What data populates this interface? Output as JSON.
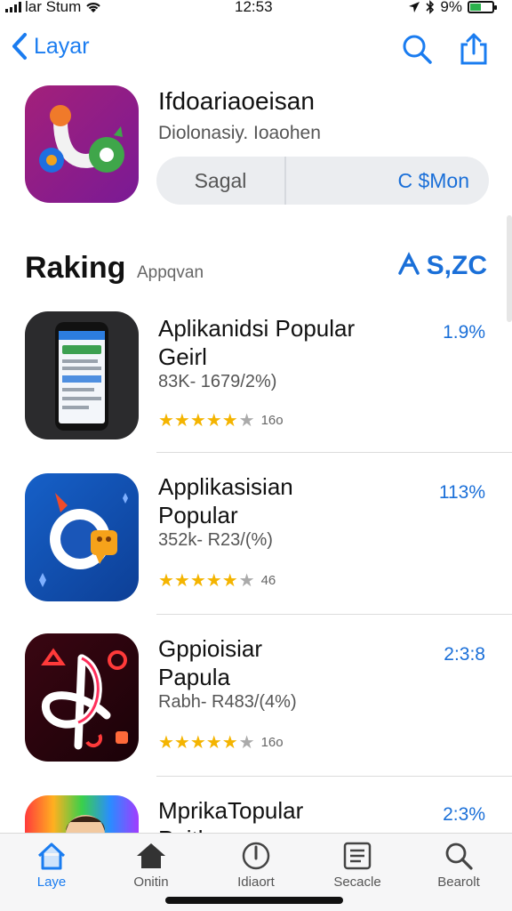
{
  "status": {
    "carrier": "lar Stum",
    "time": "12:53",
    "battery": "9%"
  },
  "nav": {
    "back_label": "Layar"
  },
  "hero": {
    "title": "Ifdoariaoeisan",
    "subtitle": "Diolonasiy. Ioaohen",
    "seg_left": "Sagal",
    "seg_right": "C $Mon"
  },
  "section": {
    "title": "Raking",
    "subtitle": "Appqvan",
    "link": "S,ZC"
  },
  "apps": [
    {
      "title_lines": [
        "Aplikanidsi Popular",
        "Geirl"
      ],
      "meta": "83K- 1679/2%)",
      "rating_count": "16o",
      "pct": "1.9%"
    },
    {
      "title_lines": [
        "Applikasisian",
        "Popular"
      ],
      "meta": "352k- R23/(%)",
      "rating_count": "46",
      "pct": "113%"
    },
    {
      "title_lines": [
        "Gppioisiar",
        "Papula"
      ],
      "meta": "Rabh- R483/(4%)",
      "rating_count": "16o",
      "pct": "2:3:8"
    },
    {
      "title_lines": [
        "MprikaTopular",
        "Poitl"
      ],
      "meta": "",
      "rating_count": "",
      "pct": "2:3%"
    }
  ],
  "tabs": [
    {
      "label": "Laye",
      "icon": "home-outline-icon"
    },
    {
      "label": "Onitin",
      "icon": "home-solid-icon"
    },
    {
      "label": "Idiaort",
      "icon": "compass-icon"
    },
    {
      "label": "Secacle",
      "icon": "list-icon"
    },
    {
      "label": "Bearolt",
      "icon": "search-icon"
    }
  ],
  "colors": {
    "accent": "#1a7cf0",
    "star": "#f4b400"
  }
}
